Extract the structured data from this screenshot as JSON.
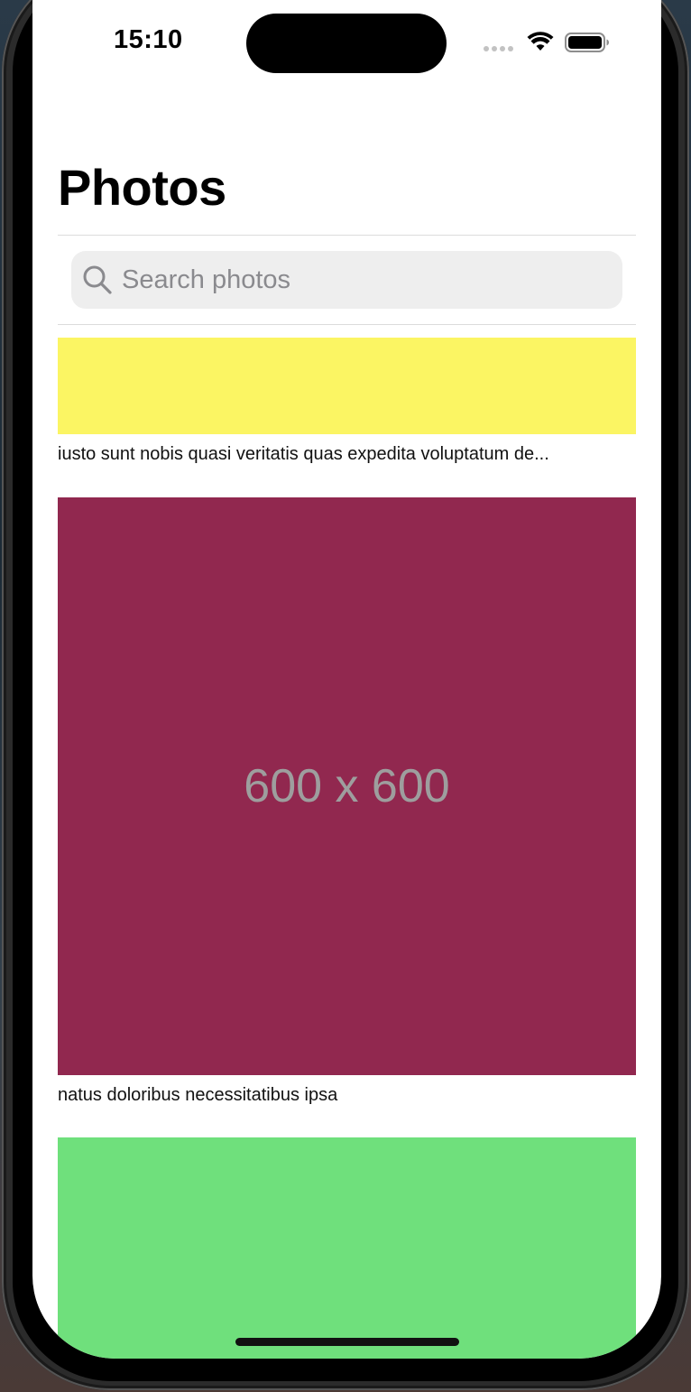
{
  "status_bar": {
    "time": "15:10"
  },
  "header": {
    "title": "Photos"
  },
  "search": {
    "placeholder": "Search photos",
    "value": ""
  },
  "photos": [
    {
      "color": "#fbf563",
      "label": "",
      "caption": "iusto sunt nobis quasi veritatis quas expedita voluptatum de..."
    },
    {
      "color": "#91284f",
      "label": "600 x 600",
      "caption": "natus doloribus necessitatibus ipsa"
    },
    {
      "color": "#6fe07c",
      "label": "",
      "caption": ""
    }
  ],
  "icons": {
    "wifi": "wifi-icon",
    "battery": "battery-icon",
    "search": "search-icon"
  }
}
